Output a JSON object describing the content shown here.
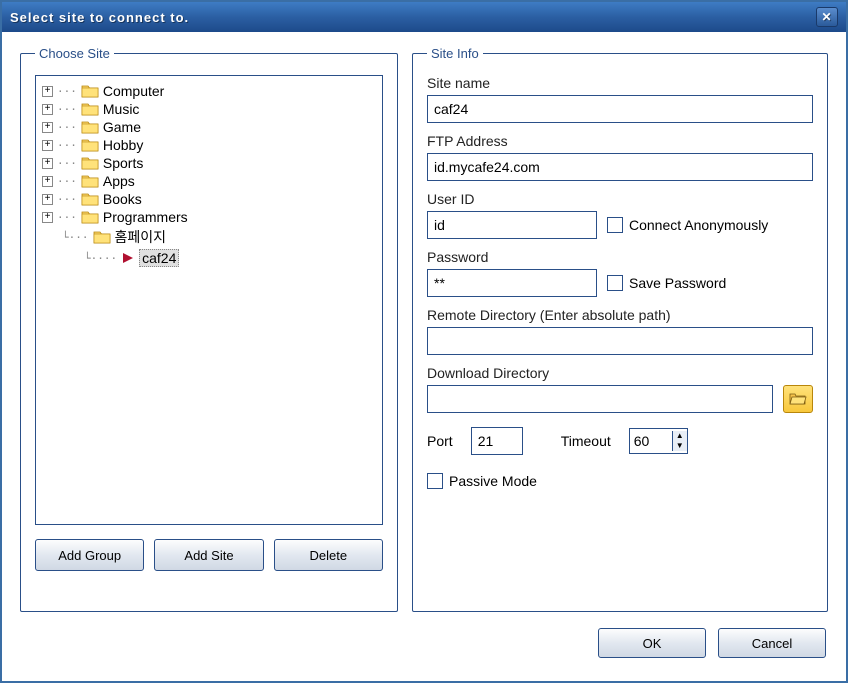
{
  "window": {
    "title": "Select site to connect to."
  },
  "chooseSite": {
    "legend": "Choose Site",
    "items": [
      {
        "label": "Computer",
        "expandable": true
      },
      {
        "label": "Music",
        "expandable": true
      },
      {
        "label": "Game",
        "expandable": true
      },
      {
        "label": "Hobby",
        "expandable": true
      },
      {
        "label": "Sports",
        "expandable": true
      },
      {
        "label": "Apps",
        "expandable": true
      },
      {
        "label": "Books",
        "expandable": true
      },
      {
        "label": "Programmers",
        "expandable": true
      }
    ],
    "child1": {
      "label": "홈페이지"
    },
    "child2": {
      "label": "caf24",
      "selected": true
    },
    "buttons": {
      "addGroup": "Add Group",
      "addSite": "Add Site",
      "delete": "Delete"
    }
  },
  "siteInfo": {
    "legend": "Site Info",
    "siteName": {
      "label": "Site name",
      "value": "caf24"
    },
    "ftpAddress": {
      "label": "FTP Address",
      "value": "id.mycafe24.com"
    },
    "userId": {
      "label": "User ID",
      "value": "id"
    },
    "connectAnon": "Connect Anonymously",
    "password": {
      "label": "Password",
      "value": "**"
    },
    "savePassword": "Save Password",
    "remoteDir": {
      "label": "Remote Directory (Enter absolute path)",
      "value": ""
    },
    "downloadDir": {
      "label": "Download Directory",
      "value": ""
    },
    "port": {
      "label": "Port",
      "value": "21"
    },
    "timeout": {
      "label": "Timeout",
      "value": "60"
    },
    "passive": "Passive Mode"
  },
  "dialogButtons": {
    "ok": "OK",
    "cancel": "Cancel"
  }
}
